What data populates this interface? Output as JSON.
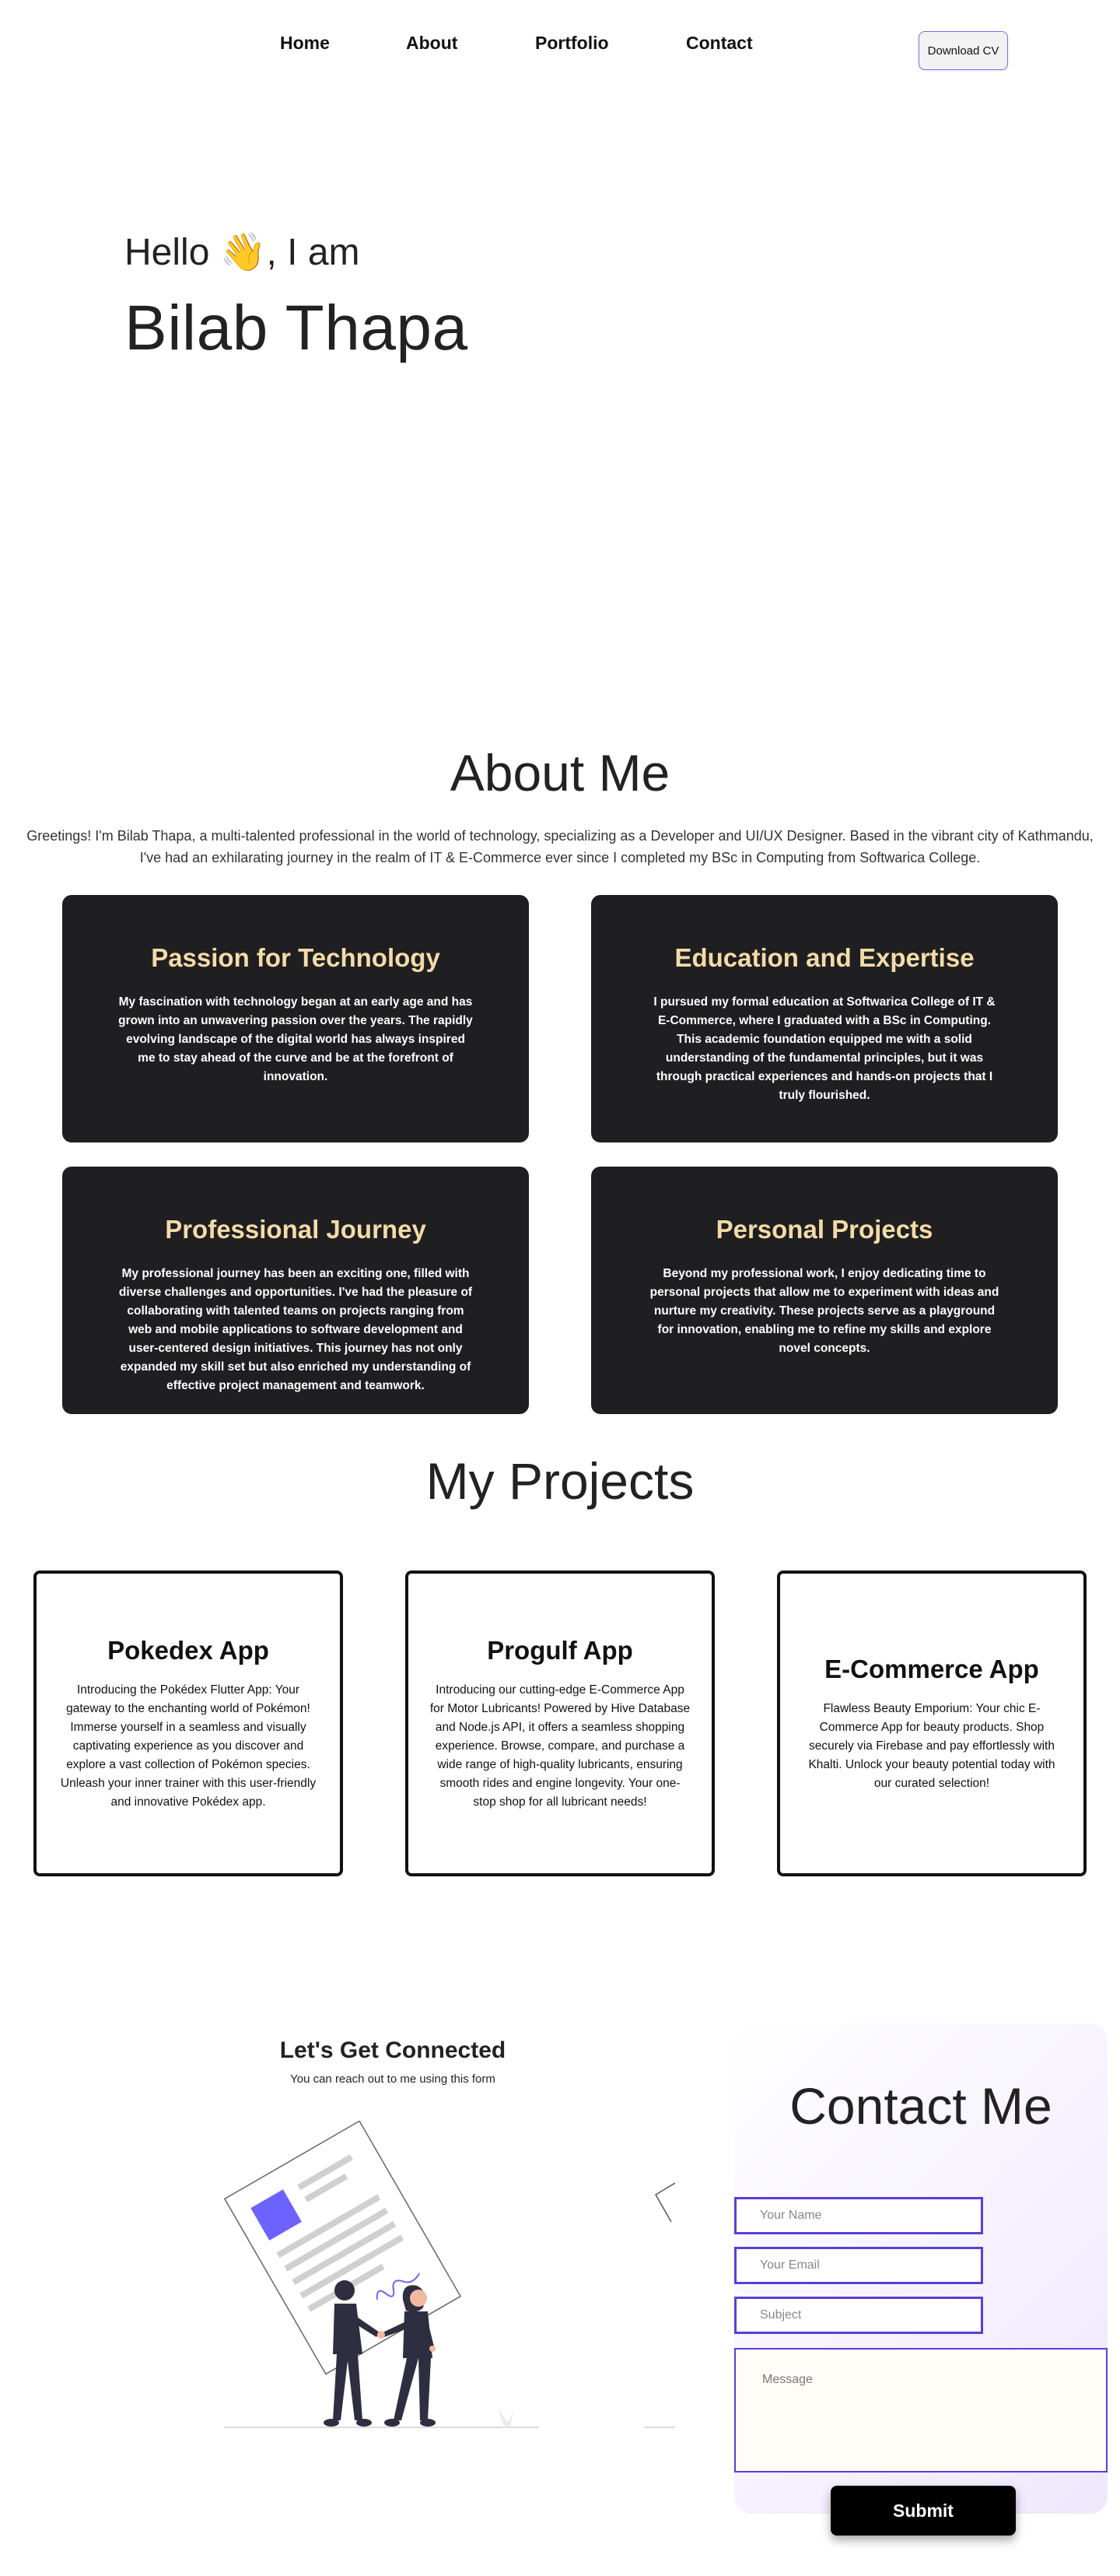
{
  "nav": {
    "links": [
      "Home",
      "About",
      "Portfolio",
      "Contact"
    ],
    "cv_button": "Download CV"
  },
  "hero": {
    "greeting": "Hello 👋, I am",
    "name": "Bilab Thapa"
  },
  "about": {
    "title": "About Me",
    "intro": "Greetings! I'm Bilab Thapa, a multi-talented professional in the world of technology, specializing as a Developer and UI/UX Designer. Based in the vibrant city of Kathmandu, I've had an exhilarating journey in the realm of IT & E-Commerce ever since I completed my BSc in Computing from Softwarica College.",
    "cards": [
      {
        "title": "Passion for Technology",
        "text": "My fascination with technology began at an early age and has grown into an unwavering passion over the years. The rapidly evolving landscape of the digital world has always inspired me to stay ahead of the curve and be at the forefront of innovation."
      },
      {
        "title": "Education and Expertise",
        "text": "I pursued my formal education at Softwarica College of IT & E-Commerce, where I graduated with a BSc in Computing. This academic foundation equipped me with a solid understanding of the fundamental principles, but it was through practical experiences and hands-on projects that I truly flourished."
      },
      {
        "title": "Professional Journey",
        "text": "My professional journey has been an exciting one, filled with diverse challenges and opportunities. I've had the pleasure of collaborating with talented teams on projects ranging from web and mobile applications to software development and user-centered design initiatives. This journey has not only expanded my skill set but also enriched my understanding of effective project management and teamwork."
      },
      {
        "title": "Personal Projects",
        "text": "Beyond my professional work, I enjoy dedicating time to personal projects that allow me to experiment with ideas and nurture my creativity. These projects serve as a playground for innovation, enabling me to refine my skills and explore novel concepts."
      }
    ]
  },
  "projects": {
    "title": "My Projects",
    "items": [
      {
        "title": "Pokedex App",
        "text": "Introducing the Pokédex Flutter App: Your gateway to the enchanting world of Pokémon! Immerse yourself in a seamless and visually captivating experience as you discover and explore a vast collection of Pokémon species. Unleash your inner trainer with this user-friendly and innovative Pokédex app."
      },
      {
        "title": "Progulf App",
        "text": "Introducing our cutting-edge E-Commerce App for Motor Lubricants! Powered by Hive Database and Node.js API, it offers a seamless shopping experience. Browse, compare, and purchase a wide range of high-quality lubricants, ensuring smooth rides and engine longevity. Your one-stop shop for all lubricant needs!"
      },
      {
        "title": "E-Commerce App",
        "text": "Flawless Beauty Emporium: Your chic E-Commerce App for beauty products. Shop securely via Firebase and pay effortlessly with Khalti. Unlock your beauty potential today with our curated selection!"
      }
    ]
  },
  "connect": {
    "title": "Let's Get Connected",
    "subtitle": "You can reach out to me using this form"
  },
  "contact": {
    "title": "Contact Me",
    "name_placeholder": "Your Name",
    "email_placeholder": "Your Email",
    "subject_placeholder": "Subject",
    "message_placeholder": "Message",
    "submit_label": "Submit"
  },
  "colors": {
    "card_bg": "#1f1f21",
    "card_title": "#f3dba8",
    "accent": "#5b3fd6",
    "illustration_accent": "#6c63ff"
  }
}
